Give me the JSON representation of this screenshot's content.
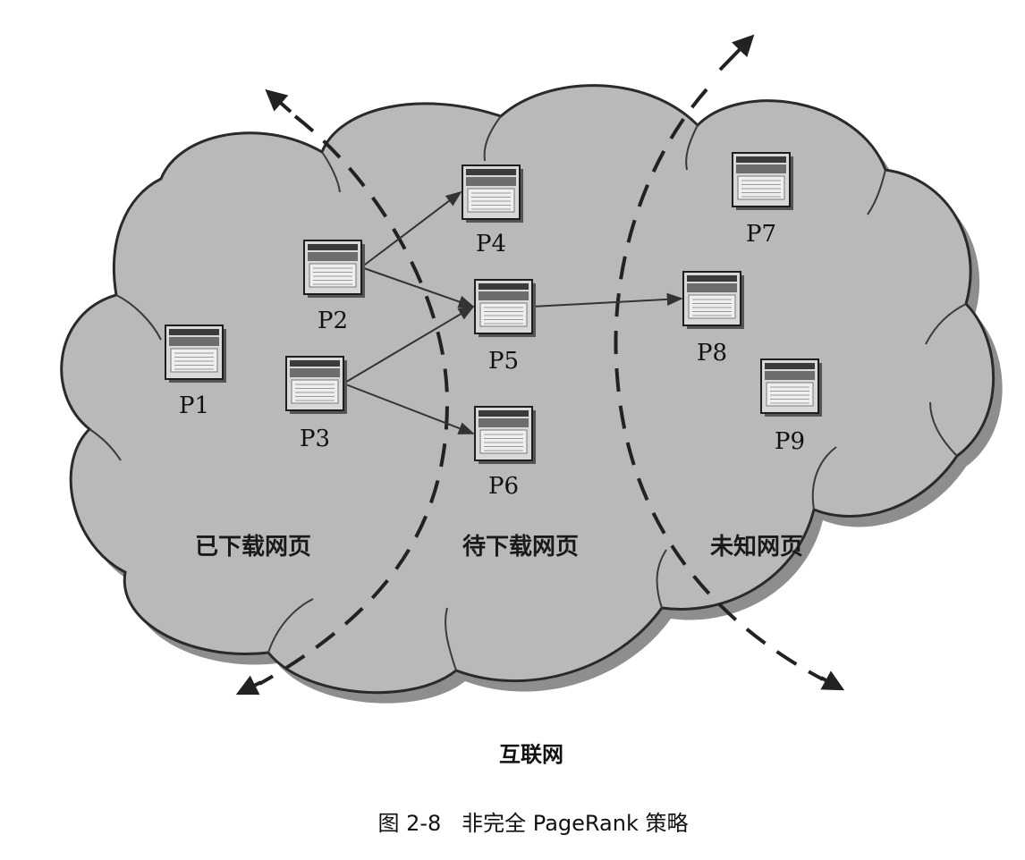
{
  "nodes": [
    {
      "id": "P1",
      "label": "P1"
    },
    {
      "id": "P2",
      "label": "P2"
    },
    {
      "id": "P3",
      "label": "P3"
    },
    {
      "id": "P4",
      "label": "P4"
    },
    {
      "id": "P5",
      "label": "P5"
    },
    {
      "id": "P6",
      "label": "P6"
    },
    {
      "id": "P7",
      "label": "P7"
    },
    {
      "id": "P8",
      "label": "P8"
    },
    {
      "id": "P9",
      "label": "P9"
    }
  ],
  "edges": [
    {
      "from": "P2",
      "to": "P4"
    },
    {
      "from": "P2",
      "to": "P5"
    },
    {
      "from": "P3",
      "to": "P5"
    },
    {
      "from": "P3",
      "to": "P6"
    },
    {
      "from": "P5",
      "to": "P8"
    }
  ],
  "regions": {
    "downloaded": "已下载网页",
    "to_download": "待下载网页",
    "unknown": "未知网页"
  },
  "network_label": "互联网",
  "caption": "图 2-8   非完全 PageRank 策略",
  "colors": {
    "cloud_fill": "#b9b9b9",
    "cloud_shadow": "#8e8e8e",
    "outline": "#2a2a2a",
    "arrow": "#333333"
  }
}
